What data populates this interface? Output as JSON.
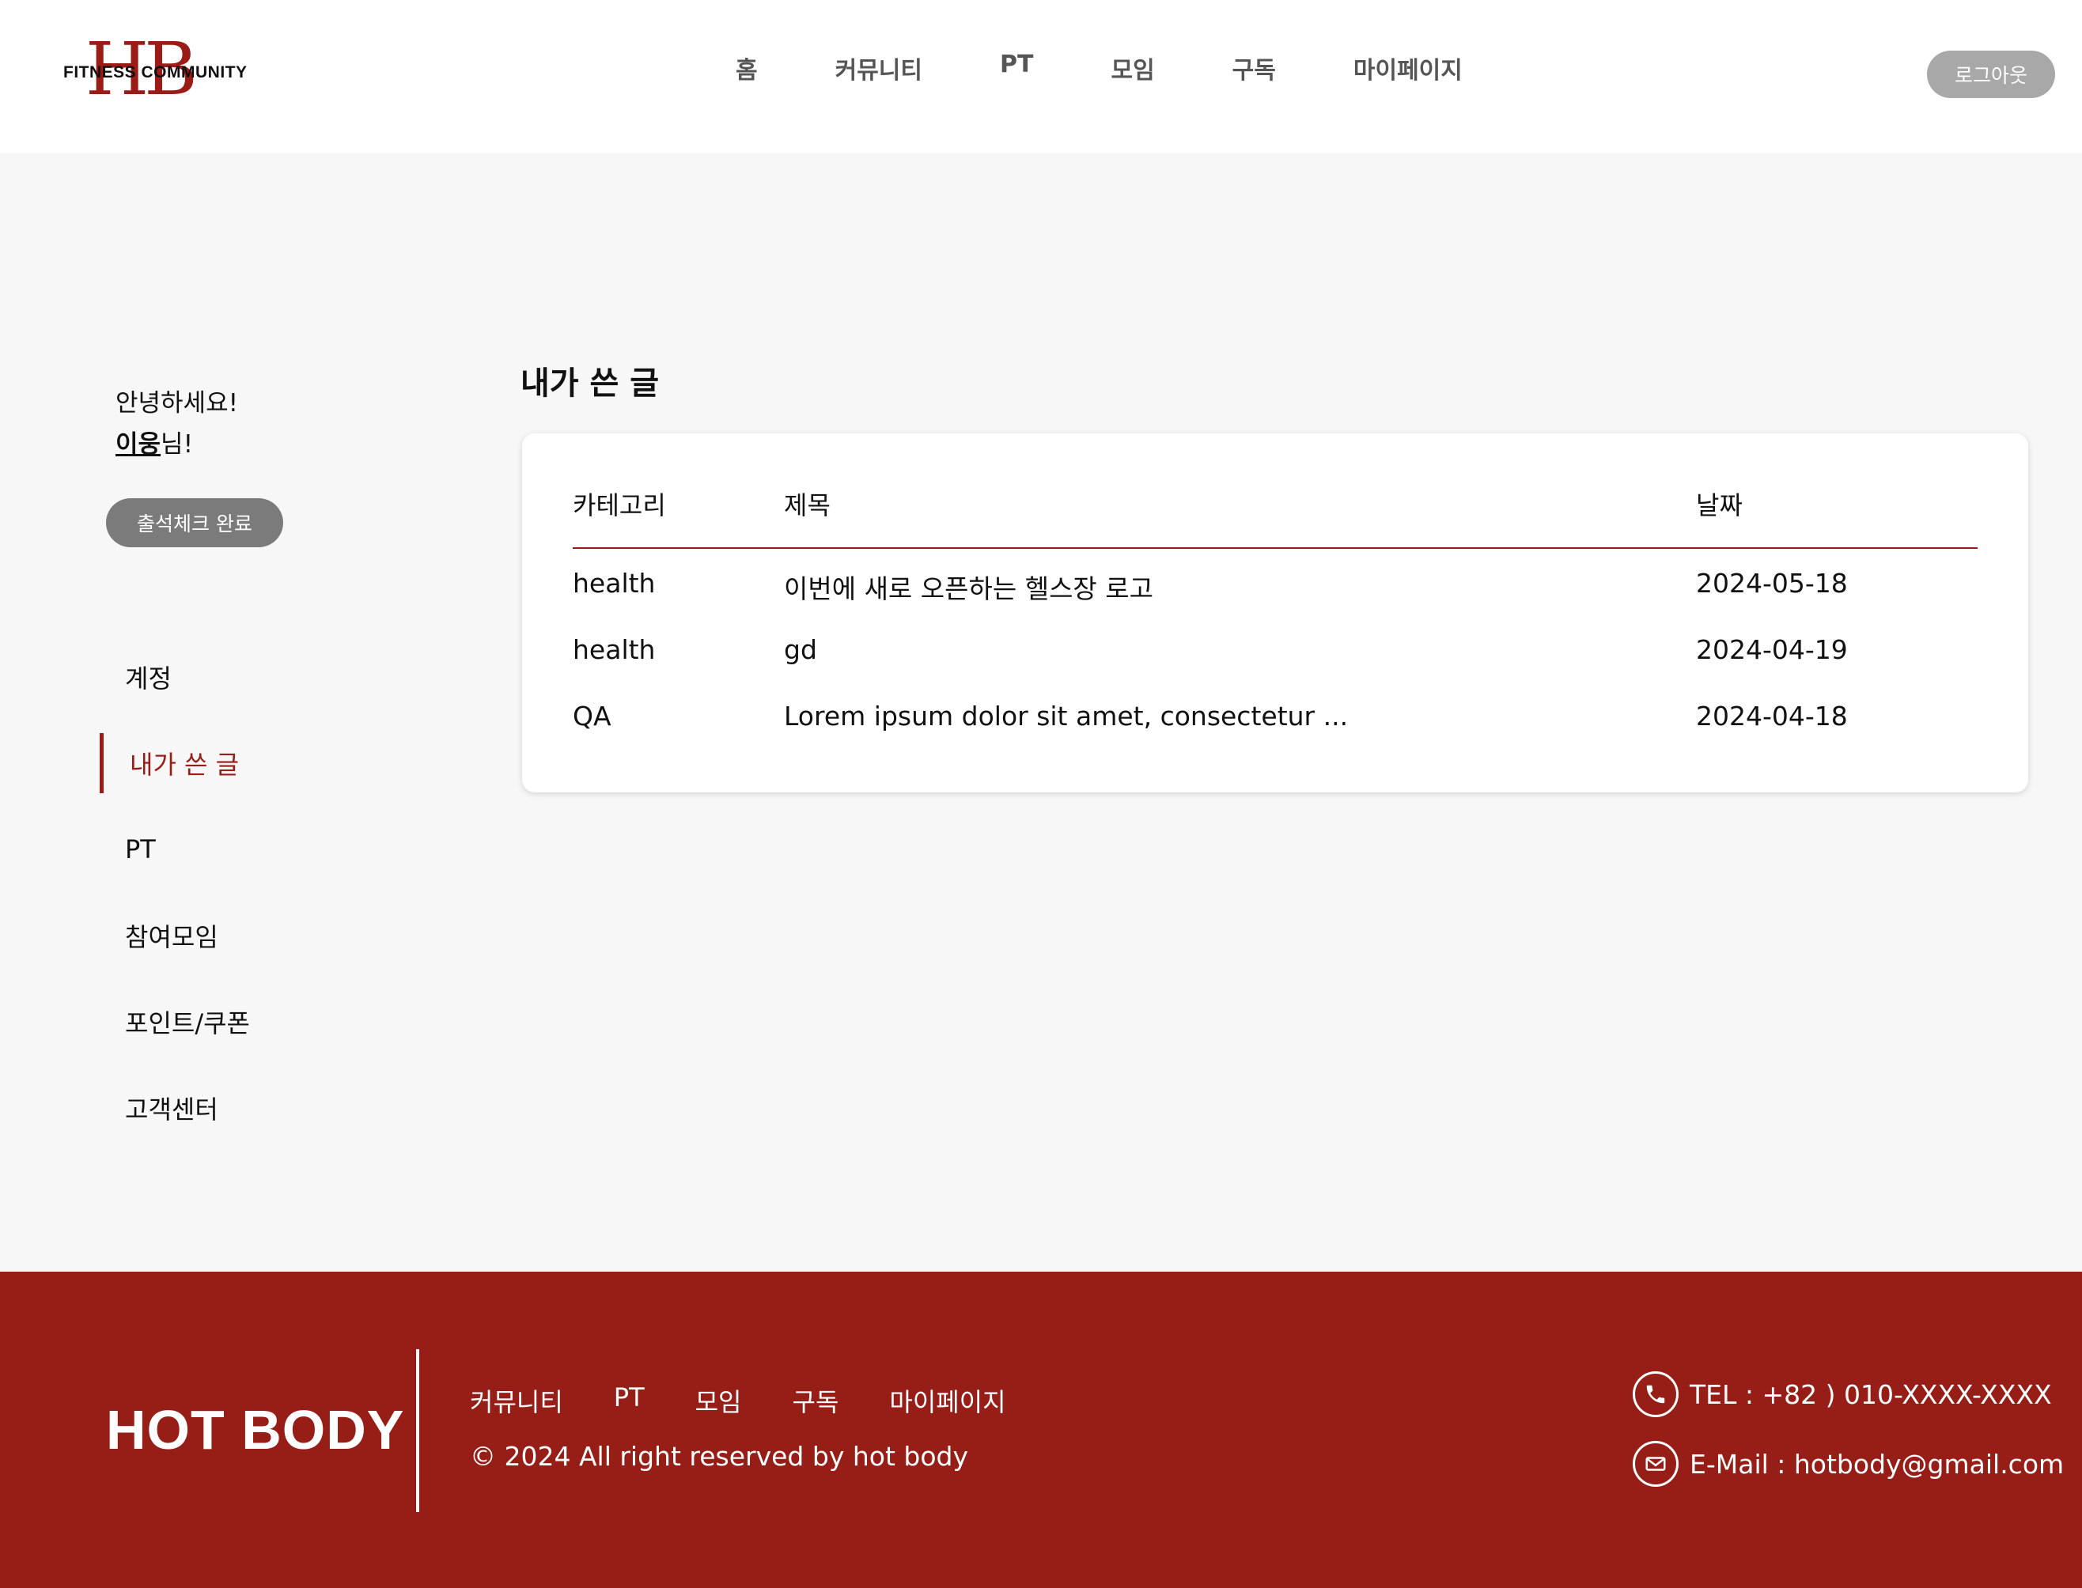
{
  "header": {
    "logo": {
      "letters": "HB",
      "text": "FITNESS COMMUNITY"
    },
    "nav": [
      "홈",
      "커뮤니티",
      "PT",
      "모임",
      "구독",
      "마이페이지"
    ],
    "logout_label": "로그아웃"
  },
  "sidebar": {
    "greeting": "안녕하세요!",
    "user_name": "이웅",
    "honorific": "님!",
    "attendance_label": "출석체크 완료",
    "menu": [
      {
        "label": "계정",
        "active": false
      },
      {
        "label": "내가 쓴 글",
        "active": true
      },
      {
        "label": "PT",
        "active": false
      },
      {
        "label": "참여모임",
        "active": false
      },
      {
        "label": "포인트/쿠폰",
        "active": false
      },
      {
        "label": "고객센터",
        "active": false
      }
    ]
  },
  "main": {
    "title": "내가 쓴 글",
    "table": {
      "headers": [
        "카테고리",
        "제목",
        "날짜"
      ],
      "rows": [
        [
          "health",
          "이번에 새로 오픈하는 헬스장 로고",
          "2024-05-18"
        ],
        [
          "health",
          "gd",
          "2024-04-19"
        ],
        [
          "QA",
          "Lorem ipsum dolor sit amet, consectetur ...",
          "2024-04-18"
        ]
      ]
    }
  },
  "footer": {
    "brand": "HOT BODY",
    "nav": [
      "커뮤니티",
      "PT",
      "모임",
      "구독",
      "마이페이지"
    ],
    "copyright": "© 2024 All right reserved by hot body",
    "tel": "TEL : +82 ) 010-XXXX-XXXX",
    "email": "E-Mail : hotbody@gmail.com",
    "icons": {
      "tel": "phone-icon",
      "email": "mail-icon"
    }
  },
  "colors": {
    "accent": "#9b1c17",
    "footer_bg": "#971d17",
    "page_bg": "#f7f7f7",
    "logout_bg": "#a8a8a8",
    "attendance_bg": "#7b7b7b"
  }
}
